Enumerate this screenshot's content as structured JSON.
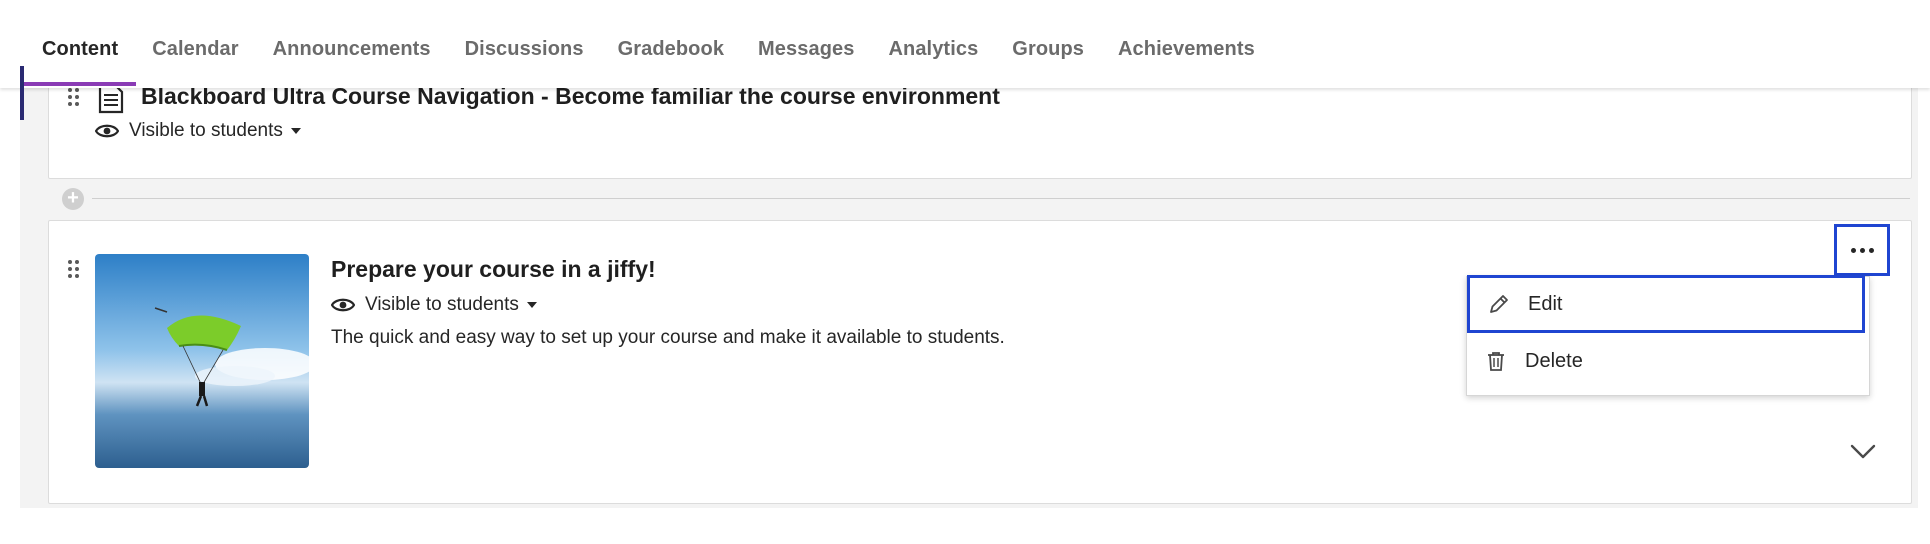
{
  "nav": {
    "tabs": [
      {
        "label": "Content",
        "active": true
      },
      {
        "label": "Calendar"
      },
      {
        "label": "Announcements"
      },
      {
        "label": "Discussions"
      },
      {
        "label": "Gradebook"
      },
      {
        "label": "Messages"
      },
      {
        "label": "Analytics"
      },
      {
        "label": "Groups"
      },
      {
        "label": "Achievements"
      }
    ]
  },
  "items": [
    {
      "title": "Blackboard Ultra Course Navigation - Become familiar the course environment",
      "visibility": "Visible to students",
      "icon": "document-icon"
    },
    {
      "title": "Prepare your course in a jiffy!",
      "visibility": "Visible to students",
      "description": "The quick and easy way to set up your course and make it available to students.",
      "thumbnail": "parachute-image"
    }
  ],
  "menu": {
    "edit_label": "Edit",
    "delete_label": "Delete"
  },
  "colors": {
    "active_tab_indicator": "#8a3bb5",
    "focus_outline": "#1f45d1"
  }
}
